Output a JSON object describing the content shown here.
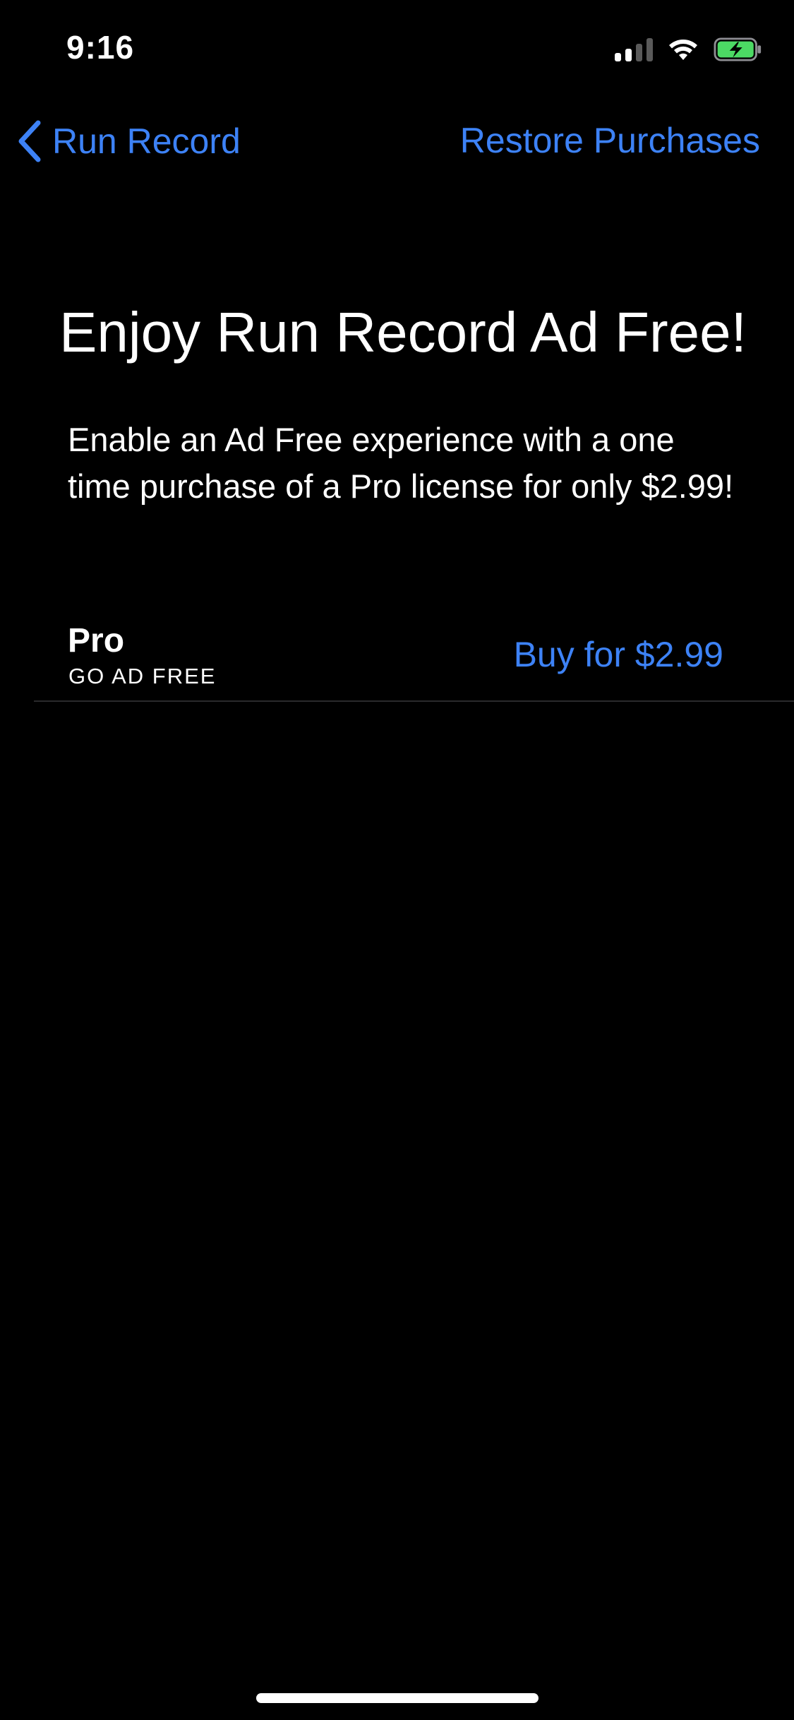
{
  "status_bar": {
    "time": "9:16",
    "icons": [
      "cellular-signal-icon",
      "wifi-icon",
      "battery-charging-icon"
    ],
    "battery_color": "#4cd964"
  },
  "nav": {
    "back_label": "Run Record",
    "back_icon": "chevron-left-icon",
    "restore_label": "Restore Purchases",
    "accent_color": "#3d82f6"
  },
  "main": {
    "title": "Enjoy Run Record Ad Free!",
    "description": "Enable an Ad Free experience with a one time purchase of a Pro license for only $2.99!",
    "product": {
      "name": "Pro",
      "subtitle": "GO AD FREE",
      "buy_label": "Buy for $2.99"
    }
  }
}
